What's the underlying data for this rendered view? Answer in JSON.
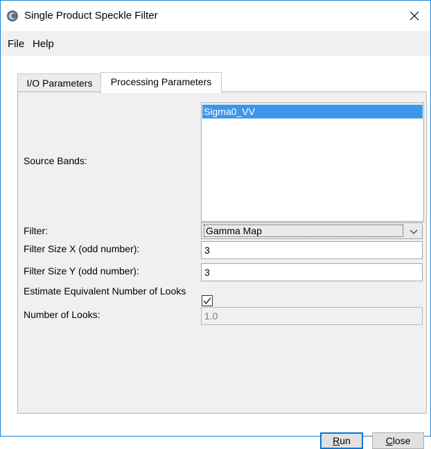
{
  "window": {
    "title": "Single Product Speckle Filter",
    "close_glyph": "✕"
  },
  "menu": {
    "items": [
      {
        "label": "File"
      },
      {
        "label": "Help"
      }
    ]
  },
  "tabs": [
    {
      "label": "I/O Parameters",
      "active": false
    },
    {
      "label": "Processing Parameters",
      "active": true
    }
  ],
  "form": {
    "source_bands_label": "Source Bands:",
    "source_bands": [
      {
        "label": "Sigma0_VV",
        "selected": true
      }
    ],
    "filter_label": "Filter:",
    "filter_value": "Gamma Map",
    "filter_size_x_label": "Filter Size X (odd number):",
    "filter_size_x_value": "3",
    "filter_size_y_label": "Filter Size Y (odd number):",
    "filter_size_y_value": "3",
    "estimate_enl_label": "Estimate Equivalent Number of Looks",
    "estimate_enl_checked": true,
    "num_looks_label": "Number of Looks:",
    "num_looks_value": "1.0"
  },
  "buttons": {
    "run": {
      "label": "Run",
      "mnemonic": "R"
    },
    "close": {
      "label": "Close",
      "mnemonic": "C"
    }
  },
  "colors": {
    "selection": "#3d96ea",
    "window_border": "#1883d7",
    "default_button_border": "#0078d7"
  },
  "icons": {
    "app": "snap-app-icon",
    "close": "close-icon",
    "dropdown": "chevron-down-icon",
    "check": "check-icon"
  }
}
